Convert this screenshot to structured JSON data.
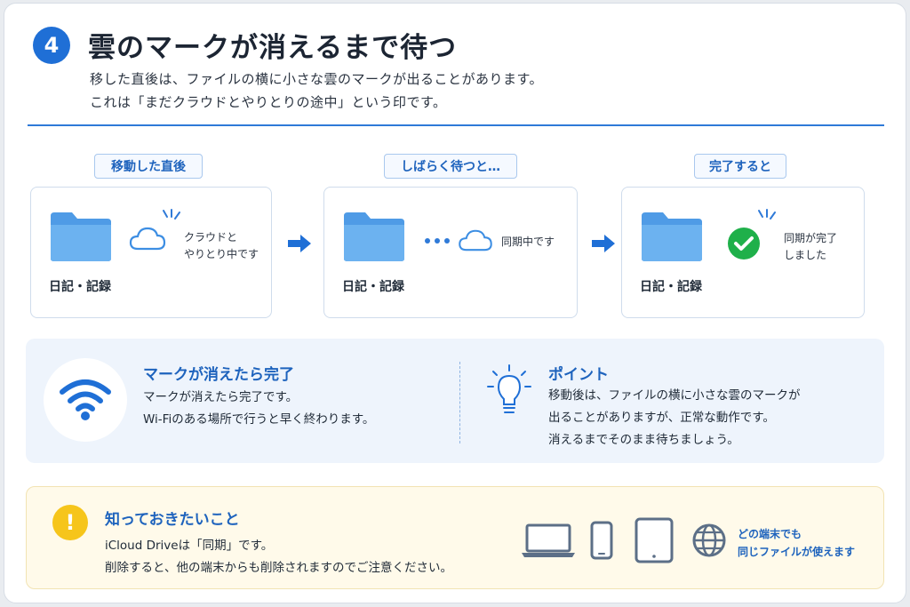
{
  "header": {
    "step_number": "4",
    "title": "雲のマークが消えるまで待つ",
    "lead_line1": "移した直後は、ファイルの横に小さな雲のマークが出ることがあります。",
    "lead_line2": "これは「まだクラウドとやりとりの途中」という印です。"
  },
  "stages": [
    {
      "label": "移動した直後",
      "folder_name": "日記・記録",
      "note_line1": "クラウドと",
      "note_line2": "やりとり中です",
      "icon": "cloud-outline-icon"
    },
    {
      "label": "しばらく待つと…",
      "folder_name": "日記・記録",
      "note_line1": "同期中です",
      "note_line2": "",
      "icon": "cloud-outline-icon"
    },
    {
      "label": "完了すると",
      "folder_name": "日記・記録",
      "note_line1": "同期が完了",
      "note_line2": "しました",
      "icon": "green-check-icon"
    }
  ],
  "info": {
    "left_heading": "マークが消えたら完了",
    "left_line1": "マークが消えたら完了です。",
    "left_line2": "Wi-Fiのある場所で行うと早く終わります。",
    "right_heading": "ポイント",
    "right_line1": "移動後は、ファイルの横に小さな雲のマークが",
    "right_line2": "出ることがありますが、正常な動作です。",
    "right_line3": "消えるまでそのまま待ちましょう。"
  },
  "warning": {
    "icon_text": "!",
    "heading": "知っておきたいこと",
    "line1": "iCloud Driveは「同期」です。",
    "line2": "削除すると、他の端末からも削除されますのでご注意ください。",
    "devices_note_line1": "どの端末でも",
    "devices_note_line2": "同じファイルが使えます"
  },
  "colors": {
    "accent": "#1f6fd6",
    "folder": "#5ea6ea",
    "success": "#1fb04a",
    "warning": "#f6c51b",
    "panel": "#eef4fc"
  }
}
